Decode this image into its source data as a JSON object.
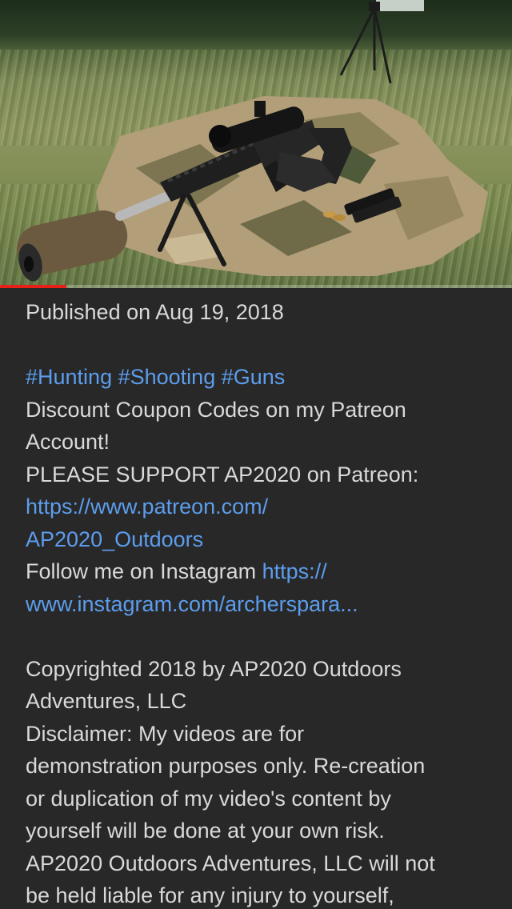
{
  "video": {
    "progress_fraction": 0.13,
    "progress_color": "#e62117"
  },
  "description": {
    "published": "Published on Aug 19, 2018",
    "hashtags": [
      "#Hunting",
      "#Shooting",
      "#Guns"
    ],
    "coupon_line_1": "Discount Coupon Codes on my Patreon",
    "coupon_line_2": "Account!",
    "patreon_text": "PLEASE SUPPORT AP2020 on Patreon:",
    "patreon_link_1": "https://www.patreon.com/",
    "patreon_link_2": "AP2020_Outdoors",
    "instagram_text": "Follow me on Instagram",
    "instagram_link_1": "https://",
    "instagram_link_2": "www.instagram.com/archerspara...",
    "copyright_1": "Copyrighted 2018 by AP2020 Outdoors",
    "copyright_2": "Adventures, LLC",
    "disclaimer_1": "Disclaimer: My videos are for",
    "disclaimer_2": "demonstration purposes only. Re-creation",
    "disclaimer_3": "or duplication of my video's content by",
    "disclaimer_4": "yourself will be done at your own risk.",
    "disclaimer_5": "AP2020 Outdoors Adventures, LLC will not",
    "disclaimer_6": "be held liable for any injury to yourself,"
  },
  "colors": {
    "background": "#282828",
    "text": "#d9d9d9",
    "link": "#5c9ded"
  }
}
